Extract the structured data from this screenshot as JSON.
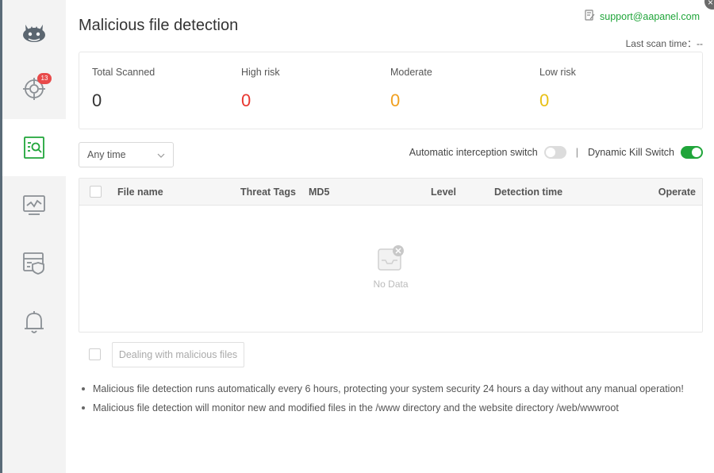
{
  "page": {
    "title": "Malicious file detection",
    "support_email": "support@aapanel.com",
    "last_scan_label": "Last scan time：",
    "last_scan_value": "--"
  },
  "sidebar": {
    "items": [
      {
        "icon": "dragon-logo-icon",
        "active": false
      },
      {
        "icon": "target-icon",
        "badge": "13",
        "active": false
      },
      {
        "icon": "file-scan-icon",
        "active": true
      },
      {
        "icon": "monitor-chart-icon",
        "active": false
      },
      {
        "icon": "server-shield-icon",
        "active": false
      },
      {
        "icon": "bell-icon",
        "active": false
      }
    ]
  },
  "stats": [
    {
      "label": "Total Scanned",
      "value": "0",
      "color": "#333333"
    },
    {
      "label": "High risk",
      "value": "0",
      "color": "#e8352e"
    },
    {
      "label": "Moderate",
      "value": "0",
      "color": "#f0a020"
    },
    {
      "label": "Low risk",
      "value": "0",
      "color": "#e8c015"
    }
  ],
  "filter": {
    "time_select": "Any time",
    "auto_interception_label": "Automatic interception switch",
    "auto_interception_on": false,
    "separator": "|",
    "dynamic_kill_label": "Dynamic Kill Switch",
    "dynamic_kill_on": true
  },
  "table": {
    "columns": [
      "File name",
      "Threat Tags",
      "MD5",
      "Level",
      "Detection time",
      "Operate"
    ],
    "rows": [],
    "empty_text": "No Data"
  },
  "actions": {
    "deal_button": "Dealing with malicious files"
  },
  "notes": [
    "Malicious file detection runs automatically every 6 hours, protecting your system security 24 hours a day without any manual operation!",
    "Malicious file detection will monitor new and modified files in the /www directory and the website directory /web/wwwroot"
  ],
  "colors": {
    "brand_green": "#20a53a",
    "badge_red": "#e84a4a"
  }
}
